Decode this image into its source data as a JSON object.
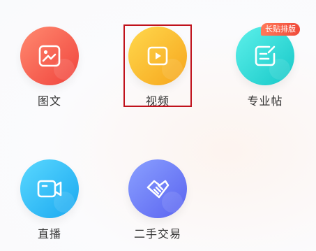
{
  "items": [
    {
      "label": "图文",
      "icon": "image-icon",
      "color": "#f0433c"
    },
    {
      "label": "视频",
      "icon": "video-play-icon",
      "color": "#f6a51c"
    },
    {
      "label": "专业帖",
      "icon": "edit-post-icon",
      "color": "#16c8c8"
    },
    {
      "label": "直播",
      "icon": "live-camera-icon",
      "color": "#1aa8f0"
    },
    {
      "label": "二手交易",
      "icon": "handshake-icon",
      "color": "#5a63f0"
    }
  ],
  "badge": {
    "text": "长贴排版"
  },
  "highlight_color": "#c0121c"
}
